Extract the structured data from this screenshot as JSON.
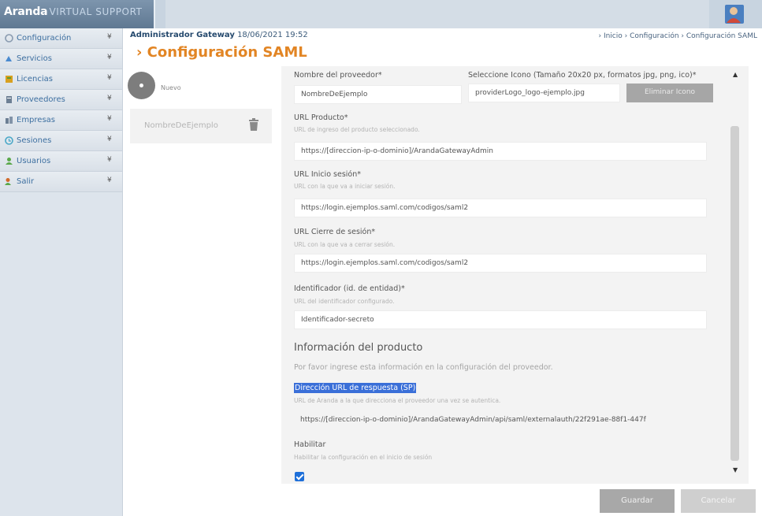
{
  "app": {
    "logo_main": "Aranda",
    "logo_sub": "VIRTUAL SUPPORT"
  },
  "sidebar": {
    "items": [
      {
        "label": "Configuración",
        "icon": "settings-icon",
        "color": "#8a9bb0"
      },
      {
        "label": "Servicios",
        "icon": "services-icon",
        "color": "#4a8ad0"
      },
      {
        "label": "Licencias",
        "icon": "licenses-icon",
        "color": "#d8a020"
      },
      {
        "label": "Proveedores",
        "icon": "providers-icon",
        "color": "#6d7f94"
      },
      {
        "label": "Empresas",
        "icon": "companies-icon",
        "color": "#6d7f94"
      },
      {
        "label": "Sesiones",
        "icon": "sessions-icon",
        "color": "#4aa8c8"
      },
      {
        "label": "Usuarios",
        "icon": "users-icon",
        "color": "#5aa84a"
      },
      {
        "label": "Salir",
        "icon": "exit-icon",
        "color": "#d06a2a"
      }
    ],
    "arrow": "¥"
  },
  "header": {
    "admin_name": "Administrador Gateway",
    "datetime": "18/06/2021 19:52",
    "breadcrumb": "› Inicio › Configuración › Configuración SAML",
    "title": "› Configuración SAML"
  },
  "providers": {
    "new_label": "Nuevo",
    "items": [
      {
        "name": "NombreDeEjemplo"
      }
    ]
  },
  "form": {
    "provider_name_label": "Nombre del proveedor*",
    "provider_name_value": "NombreDeEjemplo",
    "icon_label": "Seleccione Icono (Tamaño 20x20 px, formatos jpg, png, ico)*",
    "icon_value": "providerLogo_logo-ejemplo.jpg",
    "delete_icon_label": "Eliminar Icono",
    "product_url_label": "URL Producto*",
    "product_url_hint": "URL de ingreso del producto seleccionado.",
    "product_url_value": "https://[direccion-ip-o-dominio]/ArandaGatewayAdmin",
    "login_url_label": "URL Inicio sesión*",
    "login_url_hint": "URL con la que va a iniciar sesión.",
    "login_url_value": "https://login.ejemplos.saml.com/codigos/saml2",
    "logout_url_label": "URL Cierre de sesión*",
    "logout_url_hint": "URL con la que va a cerrar sesión.",
    "logout_url_value": "https://login.ejemplos.saml.com/codigos/saml2",
    "entity_id_label": "Identificador (id. de entidad)*",
    "entity_id_hint": "URL del identificador configurado.",
    "entity_id_value": "Identificador-secreto",
    "product_info_title": "Información del producto",
    "product_info_desc": "Por favor ingrese esta información en la configuración del proveedor.",
    "reply_url_label": "Dirección URL de respuesta (SP)",
    "reply_url_hint": "URL de Aranda a la que direcciona el proveedor una vez se autentica.",
    "reply_url_value": "https://[direccion-ip-o-dominio]/ArandaGatewayAdmin/api/saml/externalauth/22f291ae-88f1-447f",
    "enable_label": "Habilitar",
    "enable_hint": "Habilitar la configuración en el inicio de sesión",
    "enable_checked": true
  },
  "buttons": {
    "save": "Guardar",
    "cancel": "Cancelar"
  },
  "colors": {
    "accent_orange": "#e28524",
    "highlight_blue": "#3a6fd8",
    "checkbox_blue": "#1e6fd9"
  }
}
